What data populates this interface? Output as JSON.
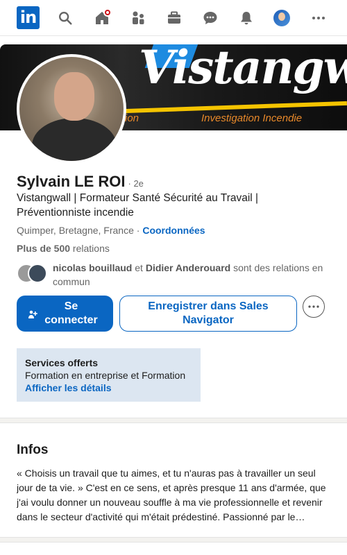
{
  "nav": {
    "logo_text": "in",
    "icons": [
      "search-icon",
      "home-icon",
      "network-icon",
      "jobs-icon",
      "messaging-icon",
      "notifications-icon",
      "me-avatar",
      "more-icon"
    ]
  },
  "banner": {
    "wordmark": "Vistangwall",
    "tag_left": "ion",
    "tag_right": "Investigation Incendie"
  },
  "profile": {
    "name": "Sylvain LE ROI",
    "degree": "· 2e",
    "headline": "Vistangwall | Formateur Santé Sécurité au Travail | Préventionniste incendie",
    "location": "Quimper, Bretagne, France",
    "location_sep": " · ",
    "contact_link": "Coordonnées",
    "connections_count": "Plus de 500",
    "connections_label": " relations",
    "mutual": {
      "person1": "nicolas bouillaud",
      "and": " et ",
      "person2": "Didier Anderouard",
      "suffix": " sont des relations en commun"
    }
  },
  "actions": {
    "connect_label": "Se connecter",
    "sales_nav_label": "Enregistrer dans Sales Navigator"
  },
  "services": {
    "title": "Services offerts",
    "description": "Formation en entreprise et Formation",
    "link": "Afficher les détails"
  },
  "about": {
    "title": "Infos",
    "text": "« Choisis un travail que tu aimes, et tu n'auras pas à travailler un seul jour de ta vie. » C'est en ce sens, et après presque 11 ans d'armée, que j'ai voulu donner un nouveau souffle à ma vie professionnelle et revenir dans le secteur d'activité qui m'était prédestiné. Passionné par le domaine de la sécurité…"
  },
  "colors": {
    "brand": "#0a66c2",
    "notification": "#cc1016",
    "banner_accent": "#f5c400",
    "services_bg": "#dce6f1"
  }
}
